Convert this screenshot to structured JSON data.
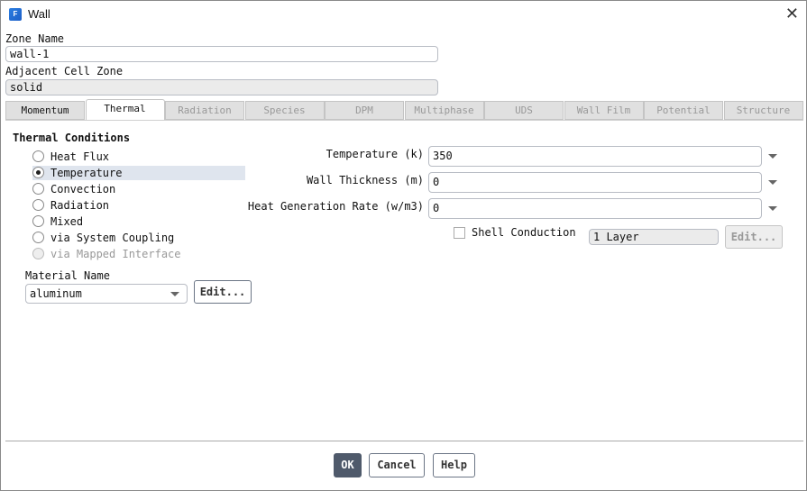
{
  "window": {
    "title": "Wall",
    "logo_letter": "F",
    "close_icon": "close-icon"
  },
  "zone": {
    "name_label": "Zone Name",
    "name_value": "wall-1",
    "adjacent_label": "Adjacent Cell Zone",
    "adjacent_value": "solid"
  },
  "tabs": [
    {
      "label": "Momentum",
      "state": "enabled"
    },
    {
      "label": "Thermal",
      "state": "active"
    },
    {
      "label": "Radiation",
      "state": "disabled"
    },
    {
      "label": "Species",
      "state": "disabled"
    },
    {
      "label": "DPM",
      "state": "disabled"
    },
    {
      "label": "Multiphase",
      "state": "disabled"
    },
    {
      "label": "UDS",
      "state": "disabled"
    },
    {
      "label": "Wall Film",
      "state": "disabled"
    },
    {
      "label": "Potential",
      "state": "disabled"
    },
    {
      "label": "Structure",
      "state": "disabled"
    }
  ],
  "thermal": {
    "heading": "Thermal Conditions",
    "options": [
      {
        "label": "Heat Flux",
        "selected": false,
        "disabled": false
      },
      {
        "label": "Temperature",
        "selected": true,
        "disabled": false
      },
      {
        "label": "Convection",
        "selected": false,
        "disabled": false
      },
      {
        "label": "Radiation",
        "selected": false,
        "disabled": false
      },
      {
        "label": "Mixed",
        "selected": false,
        "disabled": false
      },
      {
        "label": "via System Coupling",
        "selected": false,
        "disabled": false
      },
      {
        "label": "via Mapped Interface",
        "selected": false,
        "disabled": true
      }
    ],
    "material_label": "Material Name",
    "material_value": "aluminum",
    "material_edit": "Edit...",
    "params": [
      {
        "label": "Temperature (k)",
        "value": "350"
      },
      {
        "label": "Wall Thickness (m)",
        "value": "0"
      },
      {
        "label": "Heat Generation Rate (w/m3)",
        "value": "0"
      }
    ],
    "shell_label": "Shell Conduction",
    "shell_checked": false,
    "layers_value": "1 Layer",
    "shell_edit": "Edit..."
  },
  "footer": {
    "ok": "OK",
    "cancel": "Cancel",
    "help": "Help"
  }
}
